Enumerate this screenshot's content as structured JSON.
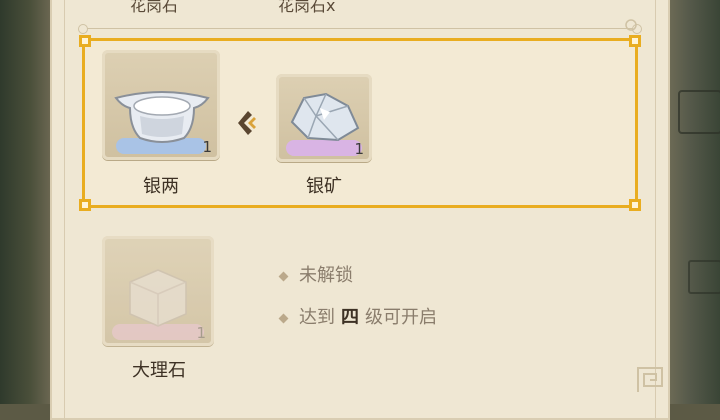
{
  "header": {
    "clipped_left": "花岗石",
    "clipped_right": "花岗石x"
  },
  "recipe": {
    "output": {
      "name": "银两",
      "count": "1",
      "icon": "silver-ingot-icon"
    },
    "input": {
      "name": "银矿",
      "count": "1",
      "icon": "silver-ore-icon"
    },
    "arrow_icon": "chevron-left-icon"
  },
  "locked": {
    "name": "大理石",
    "count": "1",
    "icon": "marble-block-icon",
    "status": "未解锁",
    "requirement_prefix": "达到",
    "requirement_level": "四",
    "requirement_suffix": "级可开启"
  },
  "colors": {
    "highlight": "#e9ad20",
    "panel": "#efe7d3",
    "output_bar": "#a9c3e6",
    "input_bar": "#d9b4e4",
    "locked_bar": "#e8c3cf"
  }
}
